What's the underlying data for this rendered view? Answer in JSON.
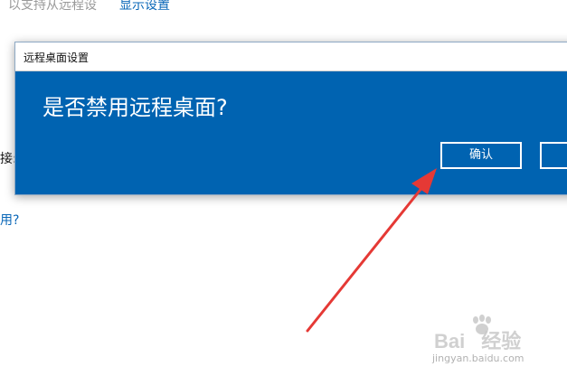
{
  "background": {
    "top_text": "以支持从远程设",
    "top_link": "显示设置",
    "left_label": "接:",
    "left_link": "用?"
  },
  "dialog": {
    "title": "远程桌面设置",
    "question": "是否禁用远程桌面?",
    "confirm_label": "确认",
    "second_label": ""
  },
  "watermark": {
    "brand": "Bai",
    "brand_suffix": "经验",
    "url": "jingyan.baidu.com"
  },
  "colors": {
    "dialog_blue": "#0063b1",
    "link_blue": "#0a67b8",
    "arrow_red": "#e53935"
  }
}
